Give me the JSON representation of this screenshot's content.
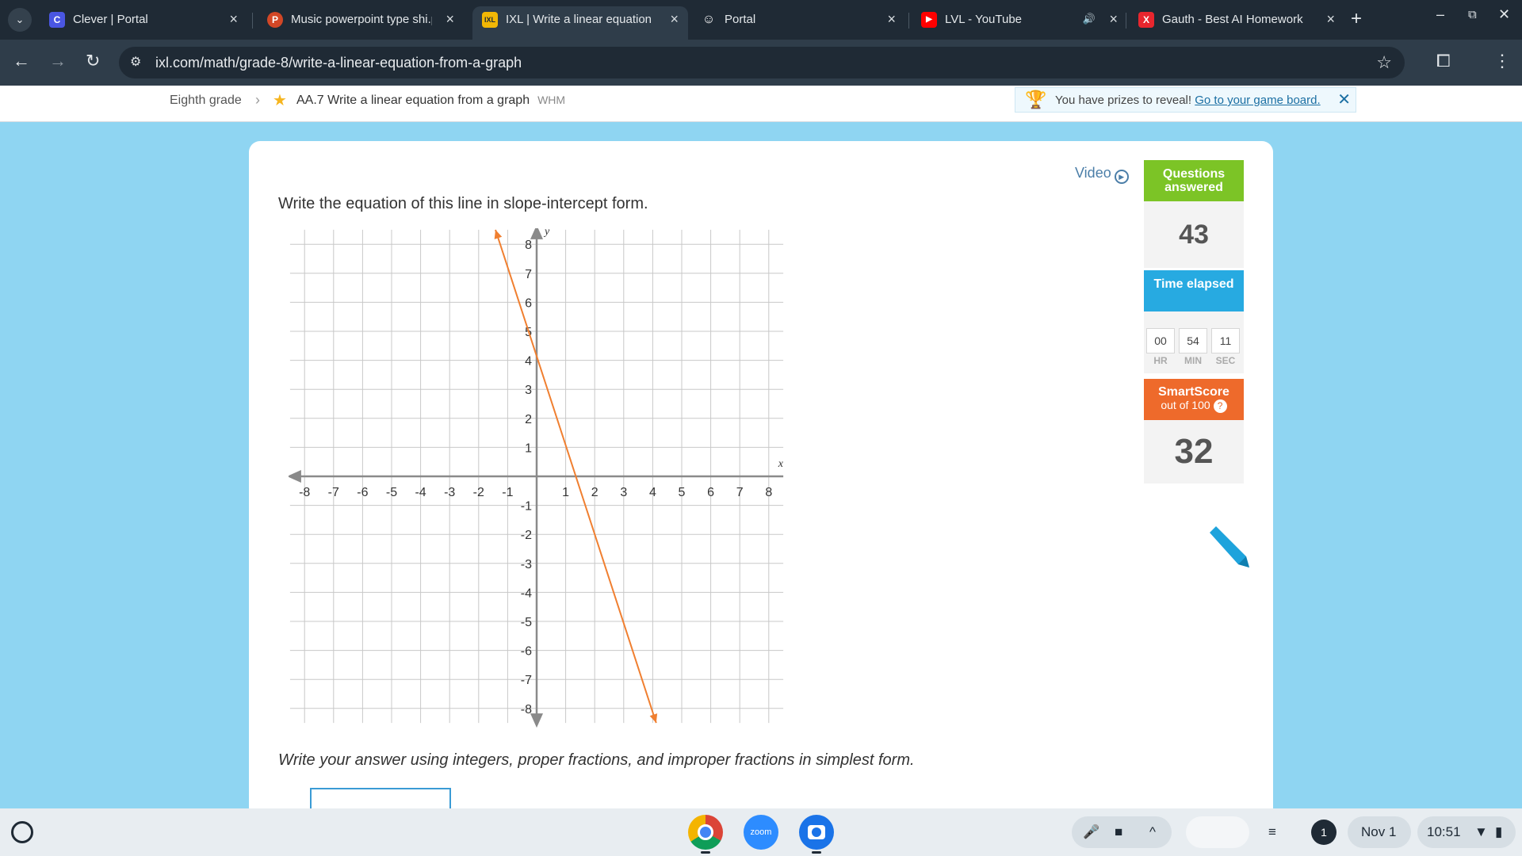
{
  "browser": {
    "tabs": [
      {
        "title": "Clever | Portal",
        "favicon": "C",
        "favicon_color": "#4a56e2"
      },
      {
        "title": "Music powerpoint type shi.p",
        "favicon": "P",
        "favicon_color": "#d24726"
      },
      {
        "title": "IXL | Write a linear equation",
        "favicon": "IXL",
        "favicon_color": "#f2b705"
      },
      {
        "title": "Portal",
        "favicon": "☺",
        "favicon_color": "#ffffff"
      },
      {
        "title": "LVL - YouTube",
        "favicon": "▶",
        "favicon_color": "#ff0000"
      },
      {
        "title": "Gauth - Best AI Homework",
        "favicon": "X",
        "favicon_color": "#e8262e"
      }
    ],
    "url": "ixl.com/math/grade-8/write-a-linear-equation-from-a-graph"
  },
  "ixl_header": {
    "breadcrumb_grade": "Eighth grade",
    "skill_title": "AA.7 Write a linear equation from a graph",
    "skill_code": "WHM",
    "prize_text": "You have prizes to reveal!",
    "prize_link": "Go to your game board."
  },
  "question": {
    "prompt": "Write the equation of this line in slope-intercept form.",
    "instruction": "Write your answer using integers, proper fractions, and improper fractions in simplest form.",
    "video_label": "Video",
    "answer_value": ""
  },
  "stats": {
    "questions_label": "Questions answered",
    "questions_count": "43",
    "time_label": "Time elapsed",
    "hr": "00",
    "min": "54",
    "sec": "11",
    "hr_label": "HR",
    "min_label": "MIN",
    "sec_label": "SEC",
    "smartscore_label": "SmartScore",
    "smartscore_sub": "out of 100",
    "smartscore_value": "32",
    "colors": {
      "questions": "#7cc426",
      "time": "#27aae1",
      "smartscore": "#ee6a2b"
    }
  },
  "chart_data": {
    "type": "line",
    "xlabel": "x",
    "ylabel": "y",
    "xlim": [
      -8,
      8
    ],
    "ylim": [
      -8,
      8
    ],
    "x_ticks": [
      -8,
      -7,
      -6,
      -5,
      -4,
      -3,
      -2,
      -1,
      1,
      2,
      3,
      4,
      5,
      6,
      7,
      8
    ],
    "y_ticks": [
      -8,
      -7,
      -6,
      -5,
      -4,
      -3,
      -2,
      -1,
      1,
      2,
      3,
      4,
      5,
      6,
      7,
      8
    ],
    "grid": true,
    "series": [
      {
        "color": "#f07f30",
        "x": [
          -1.42,
          4.12
        ],
        "y": [
          8.5,
          -8.5
        ],
        "through": [
          [
            0,
            4
          ],
          [
            1.33,
            0
          ]
        ]
      }
    ]
  },
  "shelf": {
    "apps": [
      "chrome-icon",
      "zoom-icon",
      "camera-icon"
    ],
    "zoom_label": "zoom",
    "notification_count": "1",
    "date": "Nov 1",
    "time": "10:51"
  }
}
